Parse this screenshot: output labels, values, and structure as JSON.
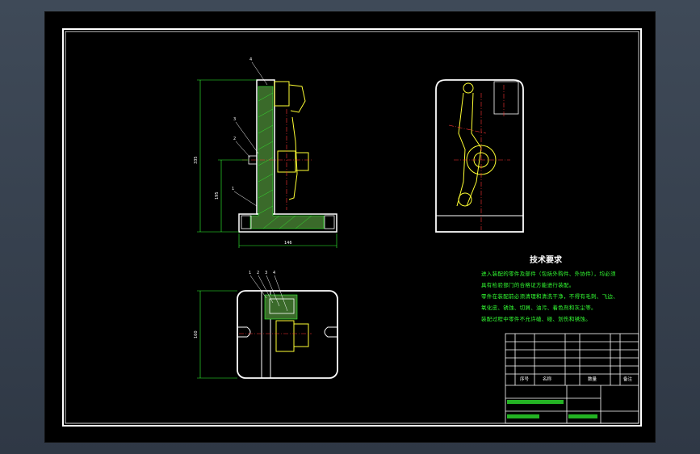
{
  "tech_requirements": {
    "title": "技术要求",
    "lines": [
      "进入装配的零件及部件（包括外购件、外协件），均必须",
      "具有检验部门的合格证方能进行装配。",
      "零件在装配前必须清理和清洗干净，不得有毛刺、飞边、",
      "氧化皮、锈蚀、切屑、油污、着色剂和灰尘等。",
      "装配过程中零件不允许磕、碰、划伤和锈蚀。"
    ]
  },
  "dimensions": {
    "front_height": "335",
    "front_mid_height": "195",
    "front_width": "146",
    "top_height": "160"
  },
  "part_bubbles": [
    "1",
    "2",
    "3",
    "4"
  ],
  "title_block": {
    "header_seq": "序号",
    "header_name": "名称",
    "header_qty": "数量",
    "header_note": "备注"
  },
  "colors": {
    "outline": "#ffffff",
    "dimension": "#33ff33",
    "centerline": "#ff3333",
    "section": "#ffff33",
    "hatch": "#33ff33"
  }
}
